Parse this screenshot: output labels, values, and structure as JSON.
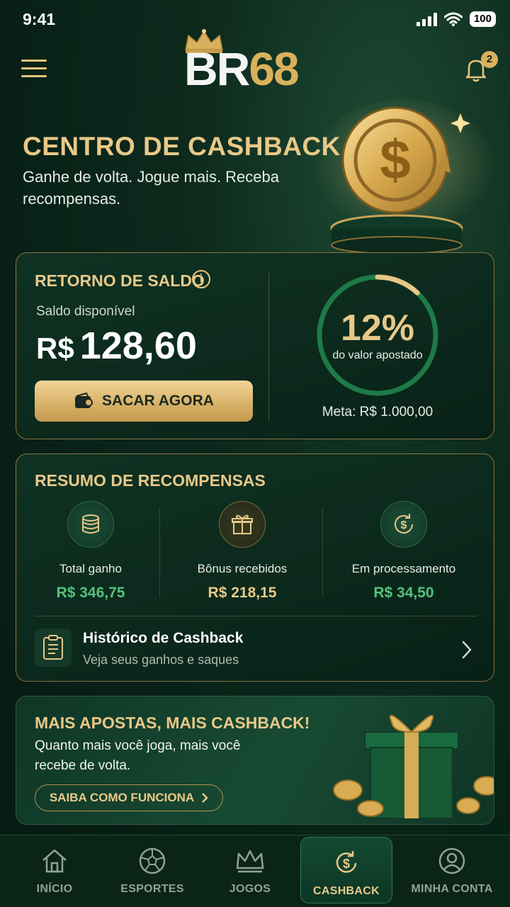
{
  "status": {
    "time": "9:41",
    "battery": "100"
  },
  "header": {
    "logo_br": "BR",
    "logo_num": "68",
    "notification_count": "2"
  },
  "hero": {
    "title": "CENTRO DE CASHBACK",
    "subtitle": "Ganhe de volta. Jogue mais. Receba recompensas."
  },
  "balance": {
    "title": "RETORNO DE SALDO",
    "info": "i",
    "label": "Saldo disponível",
    "currency": "R$",
    "amount": "128,60",
    "button": "SACAR AGORA",
    "percent": "12%",
    "percent_label": "do valor apostado",
    "goal": "Meta: R$ 1.000,00",
    "progress": 0.12
  },
  "summary": {
    "title": "RESUMO DE RECOMPENSAS",
    "stats": [
      {
        "label": "Total ganho",
        "value": "R$ 346,75",
        "icon": "coins-icon"
      },
      {
        "label": "Bônus recebidos",
        "value": "R$ 218,15",
        "icon": "gift-icon"
      },
      {
        "label": "Em processamento",
        "value": "R$ 34,50",
        "icon": "processing-icon"
      }
    ],
    "history_title": "Histórico de Cashback",
    "history_sub": "Veja seus ganhos e saques"
  },
  "promo": {
    "title": "MAIS APOSTAS, MAIS CASHBACK!",
    "subtitle": "Quanto mais você joga, mais você recebe de volta.",
    "button": "SAIBA COMO FUNCIONA"
  },
  "nav": [
    {
      "label": "INÍCIO",
      "icon": "home-icon"
    },
    {
      "label": "ESPORTES",
      "icon": "ball-icon"
    },
    {
      "label": "JOGOS",
      "icon": "crown-icon"
    },
    {
      "label": "CASHBACK",
      "icon": "cashback-icon",
      "active": true
    },
    {
      "label": "MINHA CONTA",
      "icon": "user-icon"
    }
  ],
  "colors": {
    "gold": "#e8c888",
    "green": "#57c17c",
    "background": "#082016"
  }
}
